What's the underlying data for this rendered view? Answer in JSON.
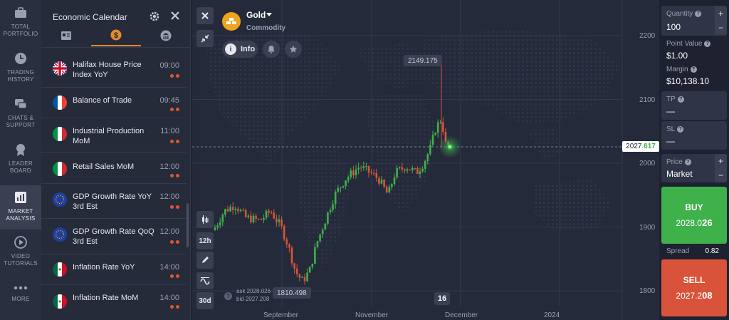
{
  "nav": {
    "items": [
      {
        "label1": "TOTAL",
        "label2": "PORTFOLIO",
        "icon": "briefcase-icon"
      },
      {
        "label1": "TRADING",
        "label2": "HISTORY",
        "icon": "clock-icon"
      },
      {
        "label1": "CHATS &",
        "label2": "SUPPORT",
        "icon": "chat-icon"
      },
      {
        "label1": "LEADER",
        "label2": "BOARD",
        "icon": "medal-icon"
      },
      {
        "label1": "MARKET",
        "label2": "ANALYSIS",
        "icon": "bar-chart-icon"
      },
      {
        "label1": "VIDEO",
        "label2": "TUTORIALS",
        "icon": "play-icon"
      },
      {
        "label1": "MORE",
        "label2": "",
        "icon": "more-dots-icon"
      }
    ]
  },
  "calendar": {
    "title": "Economic Calendar",
    "events": [
      {
        "name": "Halifax House Price Index YoY",
        "time": "09:00",
        "country": "uk"
      },
      {
        "name": "Balance of Trade",
        "time": "09:45",
        "country": "france"
      },
      {
        "name": "Industrial Production MoM",
        "time": "11:00",
        "country": "italy"
      },
      {
        "name": "Retail Sales MoM",
        "time": "12:00",
        "country": "italy"
      },
      {
        "name": "GDP Growth Rate YoY 3rd Est",
        "time": "12:00",
        "country": "eu"
      },
      {
        "name": "GDP Growth Rate QoQ 3rd Est",
        "time": "12:00",
        "country": "eu"
      },
      {
        "name": "Inflation Rate YoY",
        "time": "14:00",
        "country": "mexico"
      },
      {
        "name": "Inflation Rate MoM",
        "time": "14:00",
        "country": "mexico"
      }
    ]
  },
  "asset": {
    "name": "Gold",
    "type": "Commodity",
    "info_label": "Info"
  },
  "chart": {
    "y_ticks": [
      "2200",
      "2100",
      "2000",
      "1900",
      "1800"
    ],
    "x_ticks": [
      "September",
      "November",
      "December",
      "2024"
    ],
    "current_price_main": "2027.",
    "current_price_hl": "617",
    "high_label": "2149.175",
    "low_label": "1810.498",
    "ask": "ask 2028.026",
    "bid": "bid 2027.208",
    "day_badge": "16",
    "timeframe_12h": "12h",
    "range_30d": "30d"
  },
  "trade": {
    "quantity_label": "Quantity",
    "quantity_value": "100",
    "point_value_label": "Point Value",
    "point_value": "$1.00",
    "margin_label": "Margin",
    "margin_value": "$10,138.10",
    "tp_label": "TP",
    "tp_value": "—",
    "sl_label": "SL",
    "sl_value": "—",
    "price_label": "Price",
    "price_value": "Market",
    "buy_label": "BUY",
    "buy_price_main": "2028.0",
    "buy_price_hl": "26",
    "spread_label": "Spread",
    "spread_value": "0.82",
    "sell_label": "SELL",
    "sell_price_main": "2027.2",
    "sell_price_hl": "08"
  },
  "chart_data": {
    "type": "candlestick",
    "title": "",
    "x": [
      "September",
      "November",
      "December",
      "2024"
    ],
    "ylim": [
      1780,
      2220
    ],
    "y_ticks": [
      1800,
      1900,
      2000,
      2100,
      2200
    ],
    "high": 2149.175,
    "low": 1810.498,
    "last": 2027.617
  }
}
